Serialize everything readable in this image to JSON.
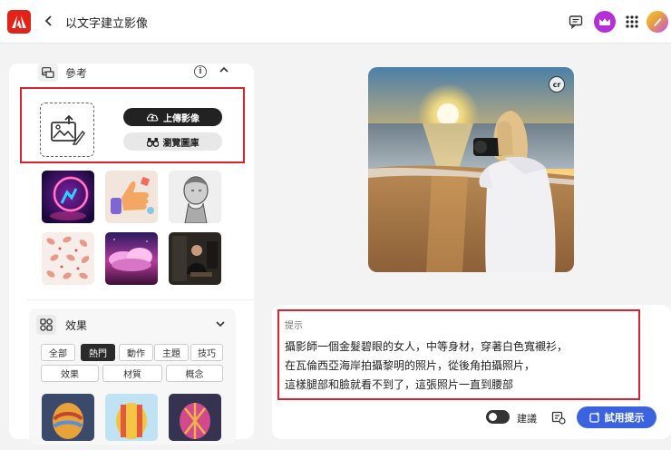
{
  "header": {
    "title": "以文字建立影像"
  },
  "reference": {
    "label": "參考",
    "upload_label": "上傳影像",
    "browse_label": "瀏覽圖庫"
  },
  "effects": {
    "label": "效果",
    "tags_row1": [
      "全部",
      "熱門",
      "動作",
      "主題",
      "技巧"
    ],
    "tags_row2": [
      "效果",
      "材質",
      "概念"
    ],
    "active_tag": "熱門"
  },
  "prompt": {
    "label": "提示",
    "line1": "攝影師一個金髮碧眼的女人，中等身材，穿著白色寬襯衫，",
    "line2": "在瓦倫西亞海岸拍攝黎明的照片，從後角拍攝照片，",
    "line3": "這樣腿部和臉就看不到了，這張照片一直到腰部",
    "suggest_label": "建議",
    "try_label": "試用提示"
  },
  "preview": {
    "badge": "cr"
  },
  "colors": {
    "accent": "#3b63e0",
    "highlight": "#d9232e",
    "brand": "#e2231a"
  }
}
